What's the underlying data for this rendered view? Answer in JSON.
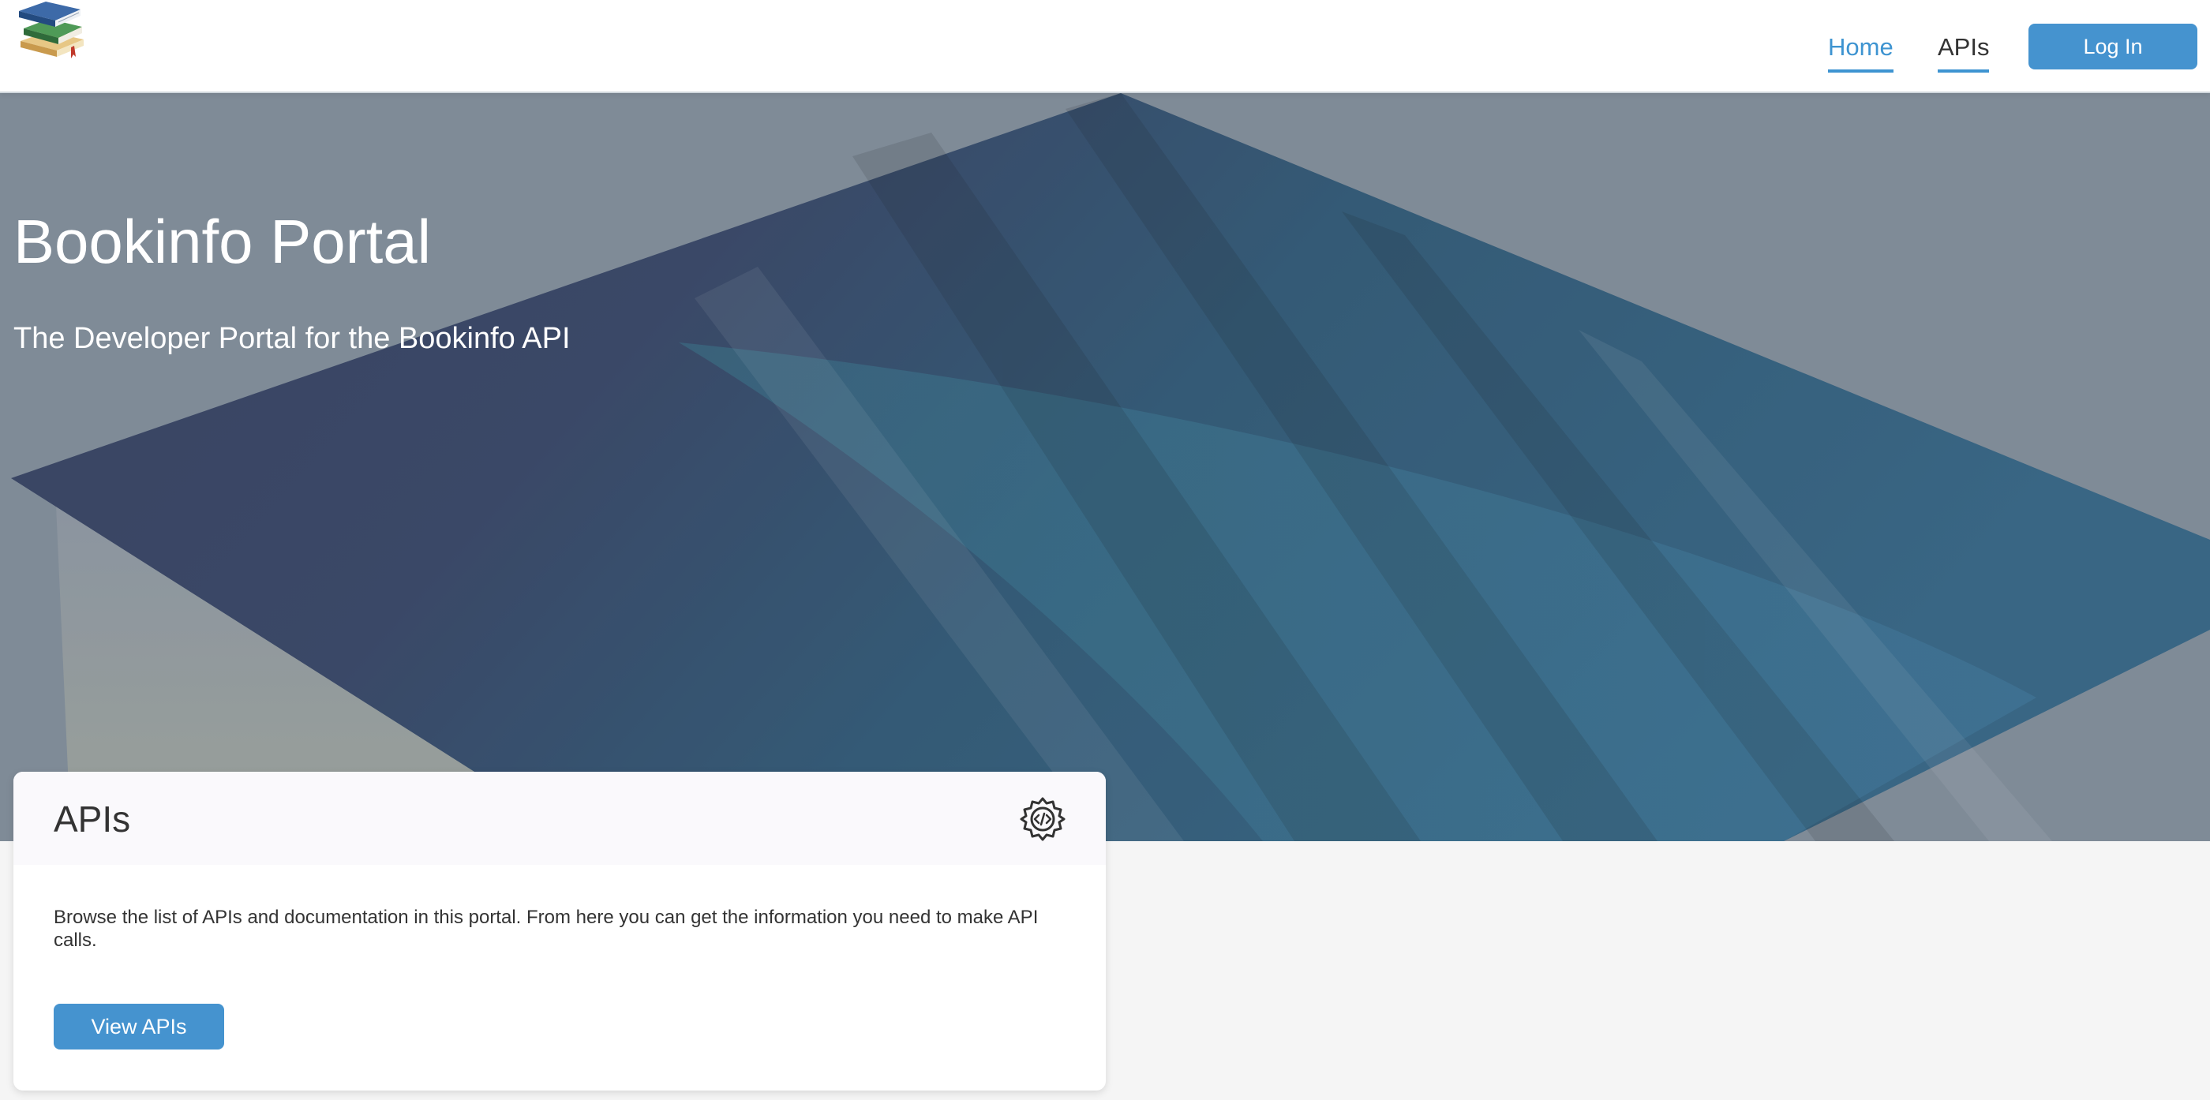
{
  "header": {
    "logo_icon": "books-stack-logo",
    "nav": {
      "home": "Home",
      "apis": "APIs"
    },
    "login_label": "Log In"
  },
  "hero": {
    "title": "Bookinfo Portal",
    "subtitle": "The Developer Portal for the Bookinfo API"
  },
  "card": {
    "title": "APIs",
    "icon": "api-gear-icon",
    "description": "Browse the list of APIs and documentation in this portal. From here you can get the information you need to make API calls.",
    "button_label": "View APIs"
  },
  "colors": {
    "accent": "#4593cf",
    "nav_active": "#3e94d1",
    "hero_overlay": "#7f8b98",
    "hero_dark": "#2c3a5c",
    "hero_blue": "#23557a"
  }
}
